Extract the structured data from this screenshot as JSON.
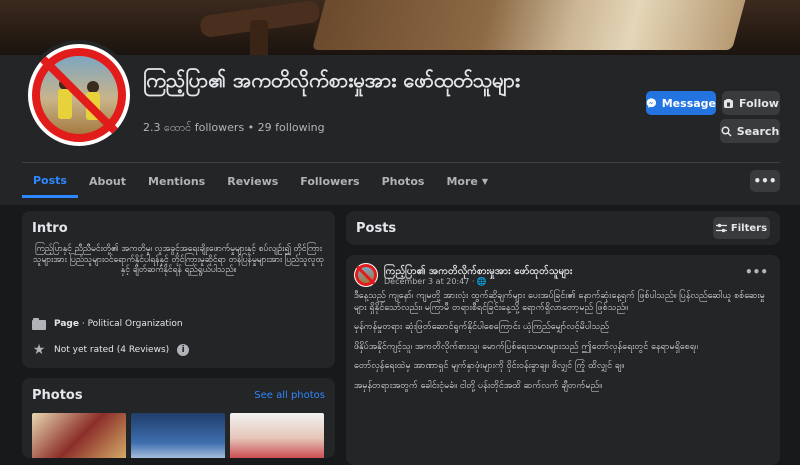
{
  "page": {
    "title": "ကြည့်ပြာ၏ အကတိလိုက်စားမှုအား ဖော်ထုတ်သူများ",
    "stats": "2.3 ထောင် followers • 29 following"
  },
  "actions": {
    "message": "Message",
    "follow": "Follow",
    "search": "Search"
  },
  "tabs": [
    {
      "label": "Posts",
      "active": true
    },
    {
      "label": "About"
    },
    {
      "label": "Mentions"
    },
    {
      "label": "Reviews"
    },
    {
      "label": "Followers"
    },
    {
      "label": "Photos"
    },
    {
      "label": "More"
    }
  ],
  "more_menu": "•••",
  "intro": {
    "heading": "Intro",
    "bio": "ကြည့်ပြာနှင့် ညီညီမင်းတို့၏ အကတိမှု၊ လူအခွင့်အရေးချိုးဖောက်မှုများနှင့် စပ်လျဉ်း၍ တိုင်ကြားသူများအား ပြည်သူများဝင်ရောက်နိုင်ပါရန်နှင့် တိုင်ကြားမှုဆိုင်ရာ တန်ပြန်မှုများအား ပြည်သူလူထုနှင့် ချိတ်ဆက်နိုင်ရန် ရည်ရွယ်ပါသည်။",
    "category_prefix": "Page",
    "category": " · Political Organization",
    "rating": "Not yet rated (4 Reviews)"
  },
  "photos": {
    "heading": "Photos",
    "see_all": "See all photos"
  },
  "posts_header": {
    "heading": "Posts",
    "filters": "Filters"
  },
  "post": {
    "author": "ကြည့်ပြာ၏ အကတိလိုက်စားမှုအား ဖော်ထုတ်သူများ",
    "date": "December 3 at 20:47 · 🌐",
    "menu": "•••",
    "paragraphs": [
      "ဒီနေ့သည် ကျနော်၊ ကျမတို့ အားလုံး ထွက်ဆိုချက်များ ပေးအပ်ခြင်း၏ နောက်ဆုံးနေ့ရက် ဖြစ်ပါသည်။ ပြန်လည်ဆေါယူ စစ်ဆေးမှုများ ရှိနိုင်သော်လည်း၊ မကြာမီ တရားစီရင်ခြင်းနေ့သို့ ရောက်ရှိလာတော့မည် ဖြစ်သည်။",
      "မှန်ကန်မှုတရား ဆုံးဖြတ်ဆောင်ရွက်နိုင်ပါစေကြောင်း ယုံကြည်မျှော်လင့်မိပါသည်",
      "ဖိနှိပ်အနိုင်ကျင့်သူ၊ အကတိလိုက်စားသူ၊ မောက်ပြစ်ရေးသမားများသည် ဤတော်လှန်ရေးတွင် နေရာမရှိစေရ။",
      "တော်လှန်ရေးထဲမှ အာဏာရှင် မျက်နှာဖုံးများကို ဝိုင်းဝန်းခွာချ။ ဖိလျှင် ကြုံ ထိလျှင် ချ။",
      "အမှန်တရားအတွက် ခေါင်းငုံမခံ။ ငါတို့ ပန်းတိုင်အထိ ဆက်လက် ချီတက်မည်။"
    ]
  },
  "colors": {
    "accent": "#2d88ff",
    "message_button": "#2374e1",
    "card_bg": "#242526",
    "page_bg": "#18191a",
    "avatar_ring": "#e21b1b"
  }
}
